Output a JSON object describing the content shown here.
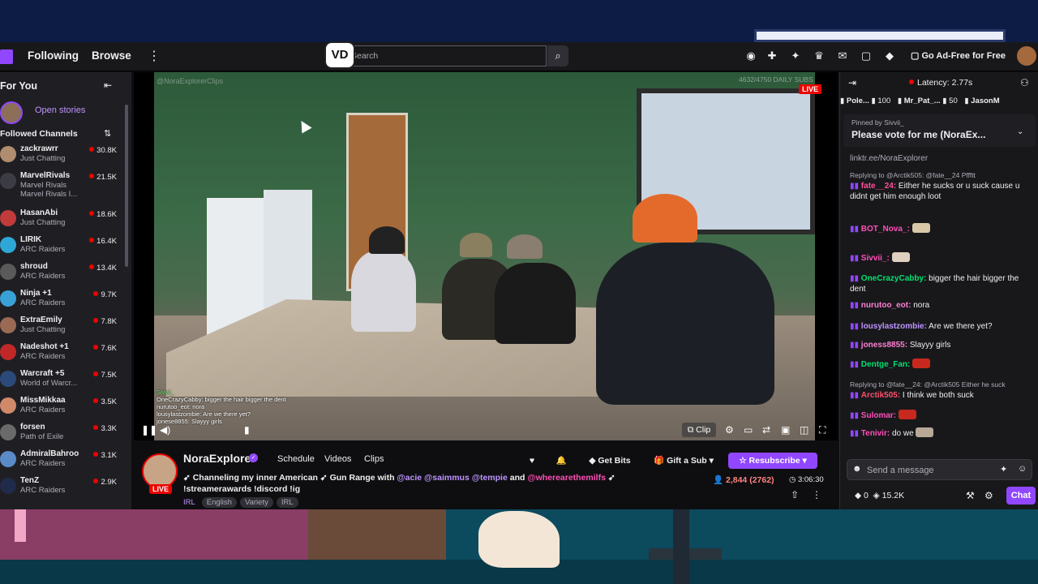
{
  "nav": {
    "following": "Following",
    "browse": "Browse",
    "search_placeholder": "Search",
    "vd_badge": "VD",
    "adfree": "Go Ad-Free for Free"
  },
  "sidebar": {
    "for_you": "For You",
    "open_stories": "Open stories",
    "followed_channels": "Followed Channels",
    "channels": [
      {
        "name": "zackrawrr",
        "game": "Just Chatting",
        "viewers": "30.8K",
        "color": "#b08d6e"
      },
      {
        "name": "MarvelRivals",
        "game": "Marvel Rivals",
        "viewers": "21.5K",
        "color": "#3c3c44",
        "extra": "Marvel Rivals I..."
      },
      {
        "name": "HasanAbi",
        "game": "Just Chatting",
        "viewers": "18.6K",
        "color": "#c23b3b"
      },
      {
        "name": "LIRIK",
        "game": "ARC Raiders",
        "viewers": "16.4K",
        "color": "#2ea7d6"
      },
      {
        "name": "shroud",
        "game": "ARC Raiders",
        "viewers": "13.4K",
        "color": "#5a5a5a"
      },
      {
        "name": "Ninja +1",
        "game": "ARC Raiders",
        "viewers": "9.7K",
        "color": "#3aa0d8"
      },
      {
        "name": "ExtraEmily",
        "game": "Just Chatting",
        "viewers": "7.8K",
        "color": "#9a6a54"
      },
      {
        "name": "Nadeshot +1",
        "game": "ARC Raiders",
        "viewers": "7.6K",
        "color": "#c02828"
      },
      {
        "name": "Warcraft +5",
        "game": "World of Warcr...",
        "viewers": "7.5K",
        "color": "#2b4a7a"
      },
      {
        "name": "MissMikkaa",
        "game": "ARC Raiders",
        "viewers": "3.5K",
        "color": "#d08a6a"
      },
      {
        "name": "forsen",
        "game": "Path of Exile",
        "viewers": "3.3K",
        "color": "#6a6a6a"
      },
      {
        "name": "AdmiralBahroo",
        "game": "ARC Raiders",
        "viewers": "3.1K",
        "color": "#5a8ac8"
      },
      {
        "name": "TenZ",
        "game": "ARC Raiders",
        "viewers": "2.9K",
        "color": "#202a4a"
      }
    ]
  },
  "player": {
    "live": "LIVE",
    "watermark": "@NoraExplorerClips",
    "stat": "4632/4750 DAILY SUBS",
    "clip": "Clip",
    "overlay_chat": [
      "Sivvii_",
      "OneCrazyCabby: bigger the hair bigger the dent",
      "nurutoo_eot: nora",
      "lousylastzombie: Are we there yet?",
      "jonese8855: Slayyy girls"
    ]
  },
  "stream": {
    "name": "NoraExplorer",
    "live": "LIVE",
    "tabs": [
      "Schedule",
      "Videos",
      "Clips"
    ],
    "title_parts": {
      "a": "Channeling my inner American",
      "b": " Gun Range with ",
      "m1": "@acie",
      "m2": "@saimmus",
      "m3": "@tempie",
      "and": " and ",
      "m4": "@wherearethemilfs",
      "c": "!streamerawards !discord !ig"
    },
    "tags": [
      "IRL",
      "English",
      "Variety",
      "IRL"
    ],
    "get_bits": "Get Bits",
    "gift_sub": "Gift a Sub",
    "resubscribe": "Resubscribe",
    "viewers": "2,844 (2762)",
    "uptime": "3:06:30"
  },
  "chat": {
    "latency": "Latency: 2.77s",
    "gifters": [
      {
        "name": "Pole...",
        "count": "100"
      },
      {
        "name": "Mr_Pat_...",
        "count": "50"
      },
      {
        "name": "JasonM",
        "count": ""
      }
    ],
    "pinned_by": "Pinned by Sivvii_",
    "pinned_msg": "Please vote for me (NoraEx...",
    "messages": [
      {
        "reply": "",
        "user": "",
        "color": "#adadb8",
        "text": "linktr.ee/NoraExplorer"
      },
      {
        "reply": "Replying to @Arctik505: @fate__24 Pffftt",
        "user": "fate__24:",
        "color": "#ff4f9a",
        "text": " Either he sucks or u suck cause u didnt get him enough loot"
      },
      {
        "reply": "",
        "user": "BOT_Nova_:",
        "color": "#ff4fb8",
        "text": ""
      },
      {
        "reply": "",
        "user": "Sivvii_:",
        "color": "#ff4fb8",
        "text": ""
      },
      {
        "reply": "",
        "user": "OneCrazyCabby:",
        "color": "#00e070",
        "text": " bigger the hair bigger the dent"
      },
      {
        "reply": "",
        "user": "nurutoo_eot:",
        "color": "#ff7fd4",
        "text": " nora"
      },
      {
        "reply": "",
        "user": "lousylastzombie:",
        "color": "#bf94ff",
        "text": " Are we there yet?"
      },
      {
        "reply": "",
        "user": "joness8855:",
        "color": "#ff7fd4",
        "text": " Slayyy girls"
      },
      {
        "reply": "",
        "user": "Dentge_Fan:",
        "color": "#00e070",
        "text": ""
      },
      {
        "reply": "Replying to @fate__24: @Arctik505 Either he suck",
        "user": "Arctik505:",
        "color": "#ff4f6a",
        "text": " I think we both suck"
      },
      {
        "reply": "",
        "user": "Sulomar:",
        "color": "#ff4fb8",
        "text": ""
      },
      {
        "reply": "",
        "user": "Tenivir:",
        "color": "#ff4fb8",
        "text": " do we"
      }
    ],
    "input_placeholder": "Send a message",
    "points_a": "0",
    "points_b": "15.2K",
    "chat_btn": "Chat"
  }
}
